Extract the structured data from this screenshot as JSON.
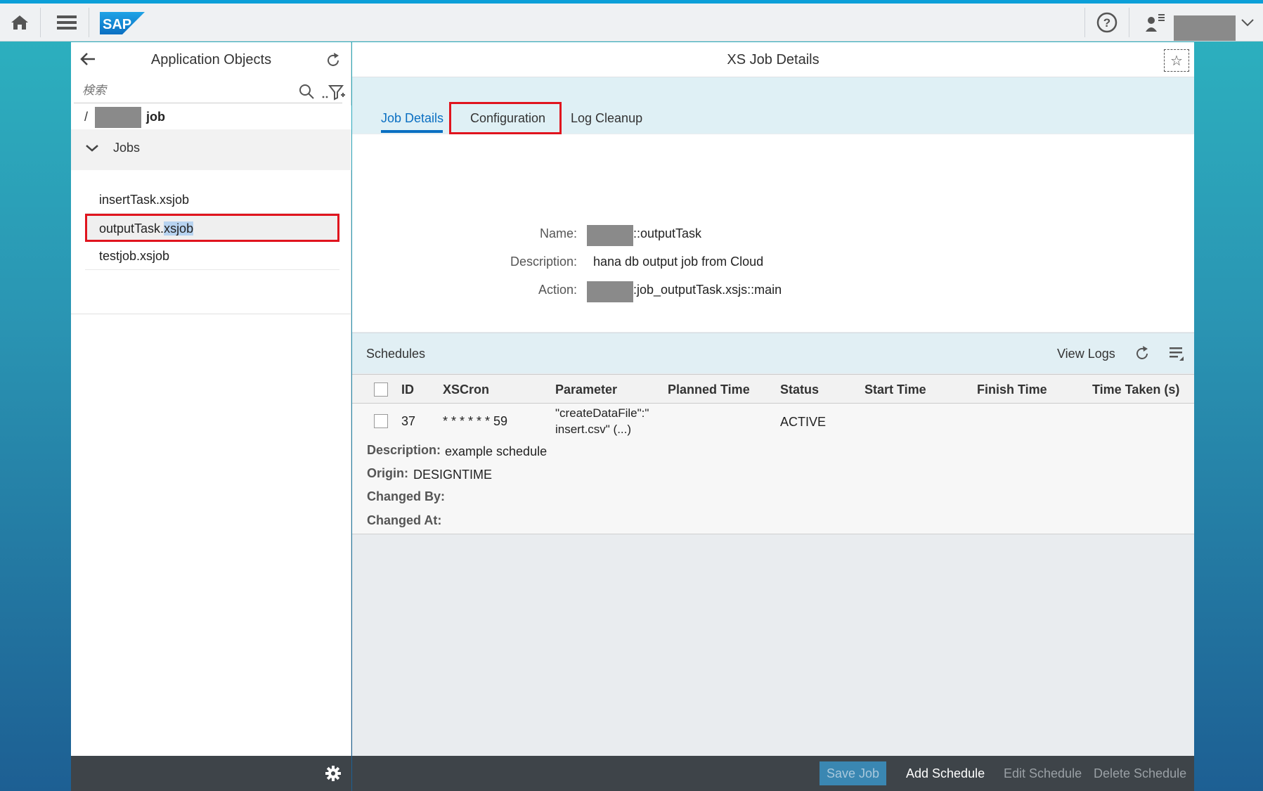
{
  "shell": {
    "logo_text": "SAP",
    "icons": [
      "home-icon",
      "menu-icon",
      "help-icon",
      "user-icon",
      "chevron-down-icon"
    ]
  },
  "left_panel": {
    "title": "Application Objects",
    "search_placeholder": "検索",
    "path_slash": "/",
    "path_name": "job",
    "folder_label": "Jobs",
    "items": [
      {
        "label": "insertTask.xsjob"
      },
      {
        "label_prefix": "outputTask.",
        "label_highlight": "xsjob"
      },
      {
        "label": "testjob.xsjob"
      }
    ]
  },
  "right_panel": {
    "title": "XS Job Details",
    "tabs": [
      {
        "label": "Job Details",
        "active": true
      },
      {
        "label": "Configuration",
        "active": false
      },
      {
        "label": "Log Cleanup",
        "active": false
      }
    ],
    "details": {
      "name_label": "Name:",
      "name_value": "::outputTask",
      "description_label": "Description:",
      "description_value": "hana db output job from Cloud",
      "action_label": "Action:",
      "action_value": ":job_outputTask.xsjs::main"
    },
    "schedules": {
      "title": "Schedules",
      "view_logs": "View Logs",
      "columns": [
        "ID",
        "XSCron",
        "Parameter",
        "Planned Time",
        "Status",
        "Start Time",
        "Finish Time",
        "Time Taken (s)"
      ],
      "row": {
        "id": "37",
        "xscron": "* * * * * * 59",
        "parameter_line1": "\"createDataFile\":\"",
        "parameter_line2": "insert.csv\" (...)",
        "status": "ACTIVE",
        "description_label": "Description",
        "description_value": "example schedule",
        "origin_label": "Origin",
        "origin_value": "DESIGNTIME",
        "changed_by_label": "Changed By",
        "changed_at_label": "Changed At",
        "colon": ":"
      }
    },
    "footer": {
      "save_job": "Save Job",
      "add_schedule": "Add Schedule",
      "edit_schedule": "Edit Schedule",
      "delete_schedule": "Delete Schedule"
    }
  },
  "colors": {
    "accent": "#0a6fc2",
    "highlight_border": "#e0141e",
    "footer_bg": "#3e4449"
  }
}
